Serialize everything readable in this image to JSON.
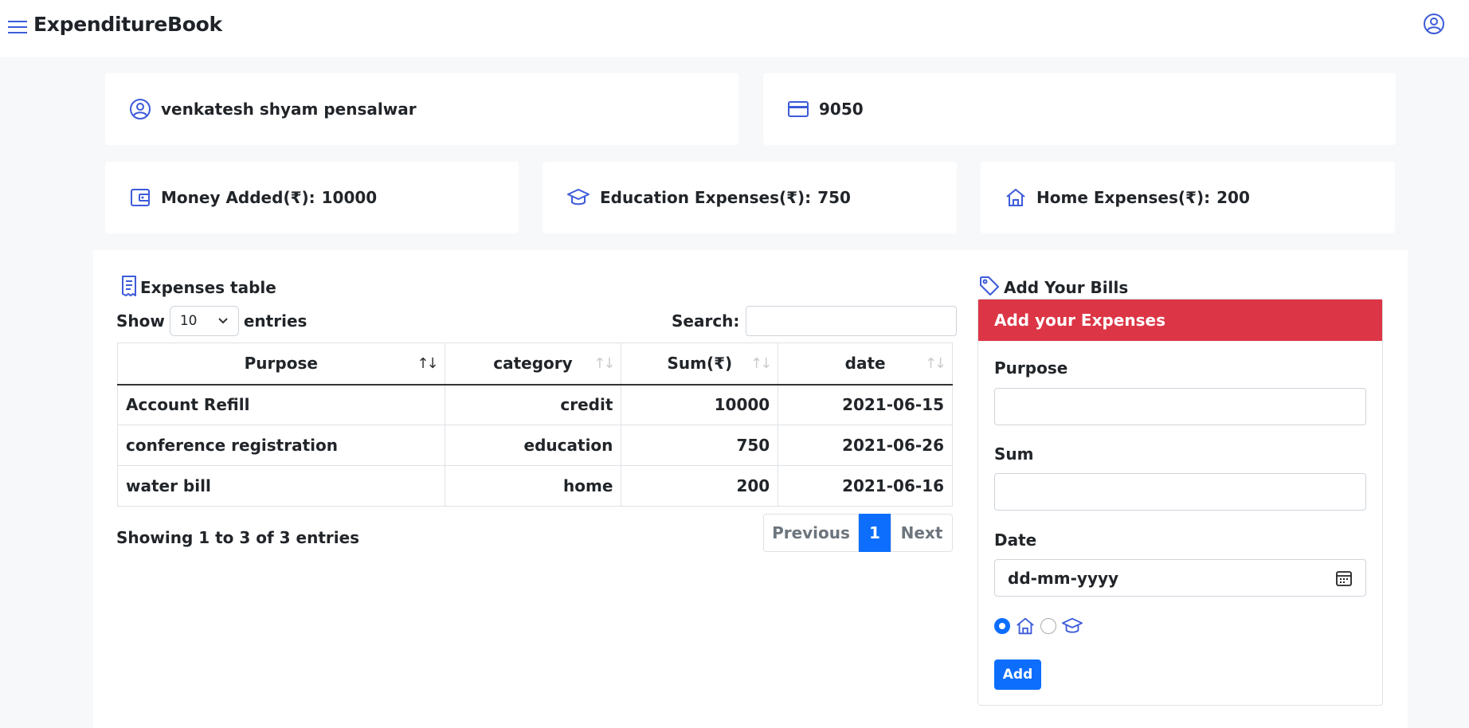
{
  "header": {
    "title": "ExpenditureBook"
  },
  "user": {
    "name": "venkatesh shyam pensalwar",
    "balance": "9050"
  },
  "stats": [
    {
      "label": "Money Added(₹):",
      "value": "10000"
    },
    {
      "label": "Education Expenses(₹):",
      "value": "750"
    },
    {
      "label": "Home Expenses(₹):",
      "value": "200"
    }
  ],
  "table_section": {
    "title": "Expenses table",
    "show_label": "Show",
    "page_size": "10",
    "entries_label": "entries",
    "search_label": "Search:",
    "search_value": "",
    "columns": [
      "Purpose",
      "category",
      "Sum(₹)",
      "date"
    ],
    "rows": [
      [
        "Account Refill",
        "credit",
        "10000",
        "2021-06-15"
      ],
      [
        "conference registration",
        "education",
        "750",
        "2021-06-26"
      ],
      [
        "water bill",
        "home",
        "200",
        "2021-06-16"
      ]
    ],
    "showing_text": "Showing 1 to 3 of 3 entries",
    "pagination": {
      "previous": "Previous",
      "current": "1",
      "next": "Next"
    }
  },
  "bills": {
    "title": "Add Your Bills",
    "form_header": "Add your Expenses",
    "purpose_label": "Purpose",
    "purpose_value": "",
    "sum_label": "Sum",
    "sum_value": "",
    "date_label": "Date",
    "date_placeholder": "dd-mm-yyyy",
    "category_icons": [
      "home-icon",
      "graduation-cap-icon"
    ],
    "add_button": "Add"
  },
  "colors": {
    "accent_blue": "#0d6efd",
    "icon_blue": "#3d5bd9",
    "header_red": "#dc3545",
    "background": "#f7f8fa"
  }
}
